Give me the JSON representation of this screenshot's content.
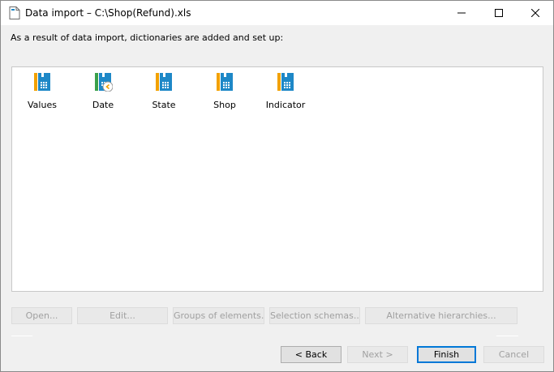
{
  "window": {
    "title": "Data import – C:\\Shop(Refund).xls"
  },
  "caption": "As a result of data import, dictionaries are added and set up:",
  "dictionaries": [
    {
      "label": "Values",
      "icon": "dictionary-icon"
    },
    {
      "label": "Date",
      "icon": "calendar-dictionary-icon"
    },
    {
      "label": "State",
      "icon": "dictionary-icon"
    },
    {
      "label": "Shop",
      "icon": "dictionary-icon"
    },
    {
      "label": "Indicator",
      "icon": "dictionary-icon"
    }
  ],
  "toolbar": {
    "open": "Open...",
    "edit": "Edit...",
    "groups": "Groups of elements...",
    "schemas": "Selection schemas...",
    "hierarchies": "Alternative hierarchies..."
  },
  "footer": {
    "back": "< Back",
    "next": "Next >",
    "finish": "Finish",
    "cancel": "Cancel"
  },
  "colors": {
    "accent_blue": "#1e88c7",
    "accent_orange": "#f2a100",
    "accent_green": "#3aa04a",
    "focus_border": "#0078d7"
  }
}
